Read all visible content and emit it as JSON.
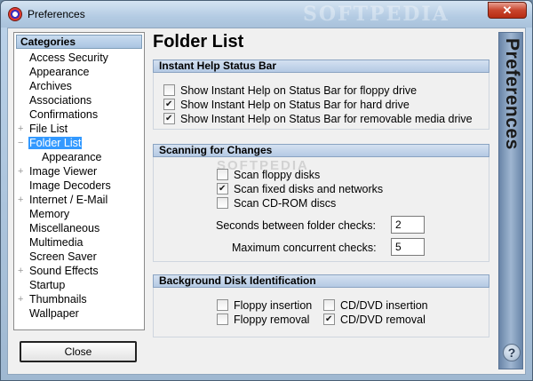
{
  "window": {
    "title": "Preferences",
    "watermark": "SOFTPEDIA"
  },
  "categories": {
    "header": "Categories",
    "items": [
      {
        "label": "Access Security",
        "expander": ""
      },
      {
        "label": "Appearance",
        "expander": ""
      },
      {
        "label": "Archives",
        "expander": ""
      },
      {
        "label": "Associations",
        "expander": ""
      },
      {
        "label": "Confirmations",
        "expander": ""
      },
      {
        "label": "File List",
        "expander": "+"
      },
      {
        "label": "Folder List",
        "expander": "−"
      },
      {
        "label": "Appearance",
        "expander": ""
      },
      {
        "label": "Image Viewer",
        "expander": "+"
      },
      {
        "label": "Image Decoders",
        "expander": ""
      },
      {
        "label": "Internet / E-Mail",
        "expander": "+"
      },
      {
        "label": "Memory",
        "expander": ""
      },
      {
        "label": "Miscellaneous",
        "expander": ""
      },
      {
        "label": "Multimedia",
        "expander": ""
      },
      {
        "label": "Screen Saver",
        "expander": ""
      },
      {
        "label": "Sound Effects",
        "expander": "+"
      },
      {
        "label": "Startup",
        "expander": ""
      },
      {
        "label": "Thumbnails",
        "expander": "+"
      },
      {
        "label": "Wallpaper",
        "expander": ""
      }
    ],
    "close_label": "Close"
  },
  "page": {
    "title": "Folder List",
    "side_banner": "Preferences",
    "help": "?",
    "watermark_mid": "SOFTPEDIA"
  },
  "instant_help": {
    "header": "Instant Help Status Bar",
    "options": [
      {
        "label": "Show Instant Help on Status Bar for floppy drive",
        "checked": false
      },
      {
        "label": "Show Instant Help on Status Bar for hard drive",
        "checked": true
      },
      {
        "label": "Show Instant Help on Status Bar for removable media drive",
        "checked": true
      }
    ]
  },
  "scanning": {
    "header": "Scanning for Changes",
    "options": [
      {
        "label": "Scan floppy disks",
        "checked": false
      },
      {
        "label": "Scan fixed disks and networks",
        "checked": true
      },
      {
        "label": "Scan CD-ROM discs",
        "checked": false
      }
    ],
    "seconds_label": "Seconds between folder checks:",
    "seconds_value": "2",
    "max_label": "Maximum concurrent checks:",
    "max_value": "5"
  },
  "background": {
    "header": "Background Disk Identification",
    "options": [
      {
        "label": "Floppy insertion",
        "checked": false
      },
      {
        "label": "CD/DVD insertion",
        "checked": false
      },
      {
        "label": "Floppy removal",
        "checked": false
      },
      {
        "label": "CD/DVD removal",
        "checked": true
      }
    ]
  }
}
